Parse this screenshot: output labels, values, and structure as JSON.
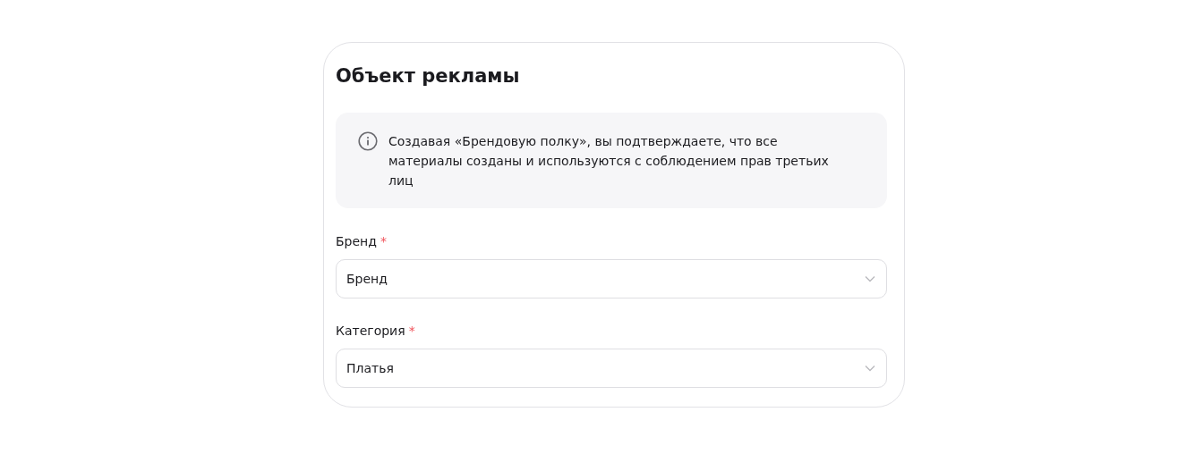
{
  "card": {
    "title": "Объект рекламы",
    "notice": {
      "text": "Создавая «Брендовую полку», вы подтверждаете, что все материалы созданы и используются с соблюдением прав третьих лиц"
    },
    "fields": [
      {
        "label": "Бренд",
        "required_mark": "*",
        "value": "Бренд"
      },
      {
        "label": "Категория",
        "required_mark": "*",
        "value": "Платья"
      }
    ]
  }
}
